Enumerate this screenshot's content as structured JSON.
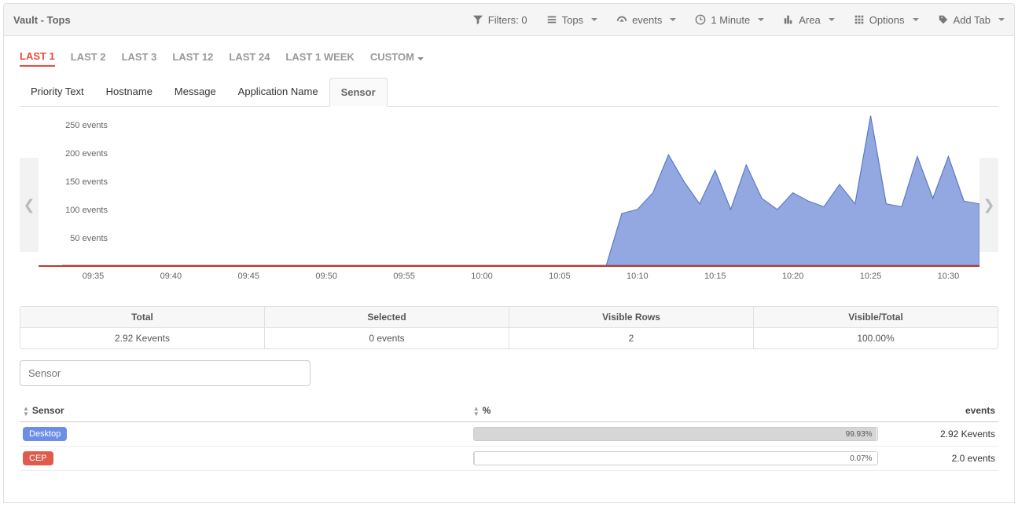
{
  "header": {
    "title": "Vault - Tops",
    "controls": {
      "filters": "Filters: 0",
      "tops": "Tops",
      "events": "events",
      "interval": "1 Minute",
      "chartType": "Area",
      "options": "Options",
      "addTab": "Add Tab"
    }
  },
  "range_tabs": [
    "LAST 1",
    "LAST 2",
    "LAST 3",
    "LAST 12",
    "LAST 24",
    "LAST 1 WEEK",
    "CUSTOM"
  ],
  "range_active": 0,
  "sub_tabs": [
    "Priority Text",
    "Hostname",
    "Message",
    "Application Name",
    "Sensor"
  ],
  "sub_active": 4,
  "stats": [
    {
      "label": "Total",
      "value": "2.92 Kevents"
    },
    {
      "label": "Selected",
      "value": "0 events"
    },
    {
      "label": "Visible Rows",
      "value": "2"
    },
    {
      "label": "Visible/Total",
      "value": "100.00%"
    }
  ],
  "filter_placeholder": "Sensor",
  "table": {
    "cols": [
      "Sensor",
      "%",
      "events"
    ],
    "rows": [
      {
        "name": "Desktop",
        "badge": "blue",
        "pct": 99.93,
        "pct_label": "99.93%",
        "events": "2.92 Kevents"
      },
      {
        "name": "CEP",
        "badge": "red",
        "pct": 0.07,
        "pct_label": "0.07%",
        "events": "2.0 events"
      }
    ]
  },
  "chart_data": {
    "type": "area",
    "ylabel": "events",
    "ylim": [
      0,
      270
    ],
    "y_ticks": [
      "50 events",
      "100 events",
      "150 events",
      "200 events",
      "250 events"
    ],
    "x_ticks": [
      "09:35",
      "09:40",
      "09:45",
      "09:50",
      "09:55",
      "10:00",
      "10:05",
      "10:10",
      "10:15",
      "10:20",
      "10:25",
      "10:30"
    ],
    "x": [
      "09:33",
      "09:34",
      "09:35",
      "09:36",
      "09:37",
      "09:38",
      "09:39",
      "09:40",
      "09:41",
      "09:42",
      "09:43",
      "09:44",
      "09:45",
      "09:46",
      "09:47",
      "09:48",
      "09:49",
      "09:50",
      "09:51",
      "09:52",
      "09:53",
      "09:54",
      "09:55",
      "09:56",
      "09:57",
      "09:58",
      "09:59",
      "10:00",
      "10:01",
      "10:02",
      "10:03",
      "10:04",
      "10:05",
      "10:06",
      "10:07",
      "10:08",
      "10:09",
      "10:10",
      "10:11",
      "10:12",
      "10:13",
      "10:14",
      "10:15",
      "10:16",
      "10:17",
      "10:18",
      "10:19",
      "10:20",
      "10:21",
      "10:22",
      "10:23",
      "10:24",
      "10:25",
      "10:26",
      "10:27",
      "10:28",
      "10:29",
      "10:30",
      "10:31",
      "10:32"
    ],
    "values": [
      0,
      0,
      0,
      0,
      0,
      0,
      0,
      0,
      0,
      0,
      0,
      0,
      0,
      0,
      0,
      0,
      0,
      0,
      0,
      0,
      0,
      0,
      0,
      0,
      0,
      0,
      0,
      0,
      0,
      0,
      0,
      0,
      0,
      0,
      0,
      0,
      93,
      100,
      130,
      198,
      150,
      110,
      170,
      100,
      180,
      120,
      100,
      130,
      115,
      105,
      145,
      110,
      268,
      110,
      105,
      195,
      120,
      195,
      115,
      110
    ]
  }
}
